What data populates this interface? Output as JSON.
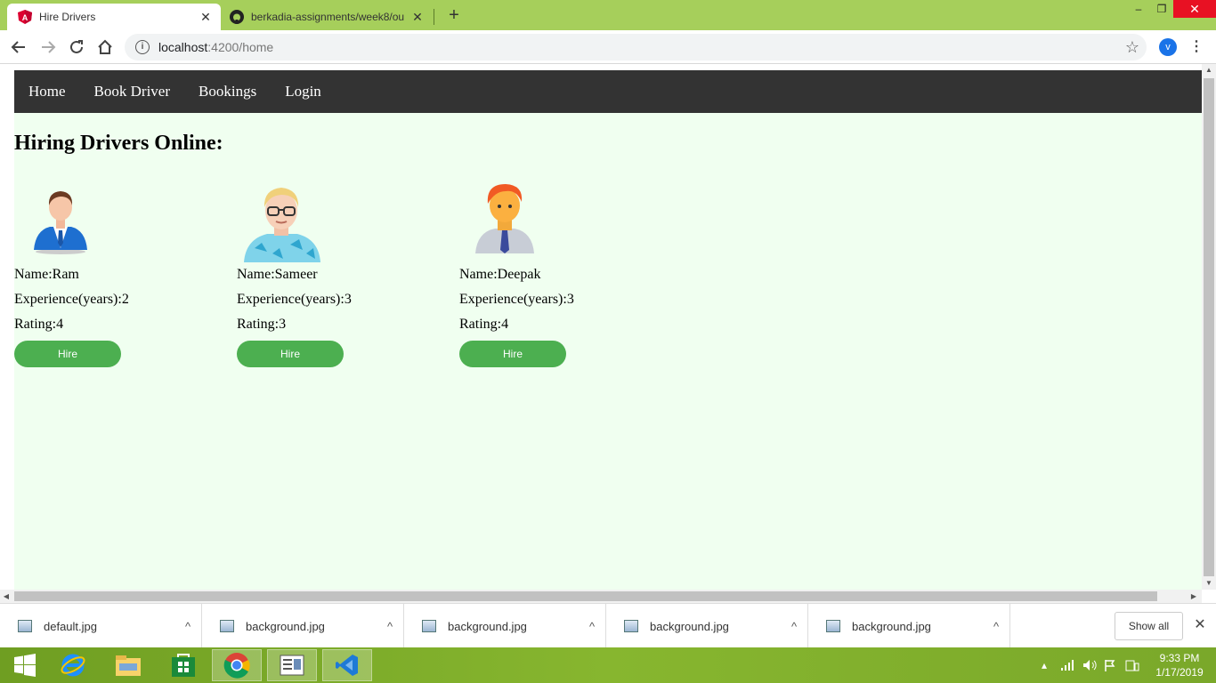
{
  "browser": {
    "tabs": [
      {
        "title": "Hire Drivers",
        "active": true,
        "icon": "angular-icon"
      },
      {
        "title": "berkadia-assignments/week8/ou",
        "active": false,
        "icon": "github-icon"
      }
    ],
    "url_host": "localhost",
    "url_path": ":4200/home",
    "profile_initial": "v"
  },
  "page": {
    "nav": [
      "Home",
      "Book Driver",
      "Bookings",
      "Login"
    ],
    "heading": "Hiring Drivers Online:",
    "drivers": [
      {
        "name": "Name:Ram",
        "experience": "Experience(years):2",
        "rating": "Rating:4",
        "button": "Hire",
        "avatar": "businessman-blue-suit-icon"
      },
      {
        "name": "Name:Sameer",
        "experience": "Experience(years):3",
        "rating": "Rating:3",
        "button": "Hire",
        "avatar": "blond-man-glasses-icon"
      },
      {
        "name": "Name:Deepak",
        "experience": "Experience(years):3",
        "rating": "Rating:4",
        "button": "Hire",
        "avatar": "redhead-man-tie-icon"
      }
    ]
  },
  "downloads": {
    "files": [
      "default.jpg",
      "background.jpg",
      "background.jpg",
      "background.jpg",
      "background.jpg"
    ],
    "show_all": "Show all"
  },
  "taskbar": {
    "apps": [
      "windows-start-icon",
      "internet-explorer-icon",
      "file-explorer-icon",
      "windows-store-icon",
      "chrome-icon",
      "reader-icon",
      "vscode-icon"
    ],
    "time": "9:33 PM",
    "date": "1/17/2019"
  },
  "colors": {
    "tab_strip": "#a6cf5b",
    "navbar": "#333333",
    "page_bg": "#f0fff0",
    "hire_button": "#4caf50",
    "close_button": "#e81123"
  }
}
